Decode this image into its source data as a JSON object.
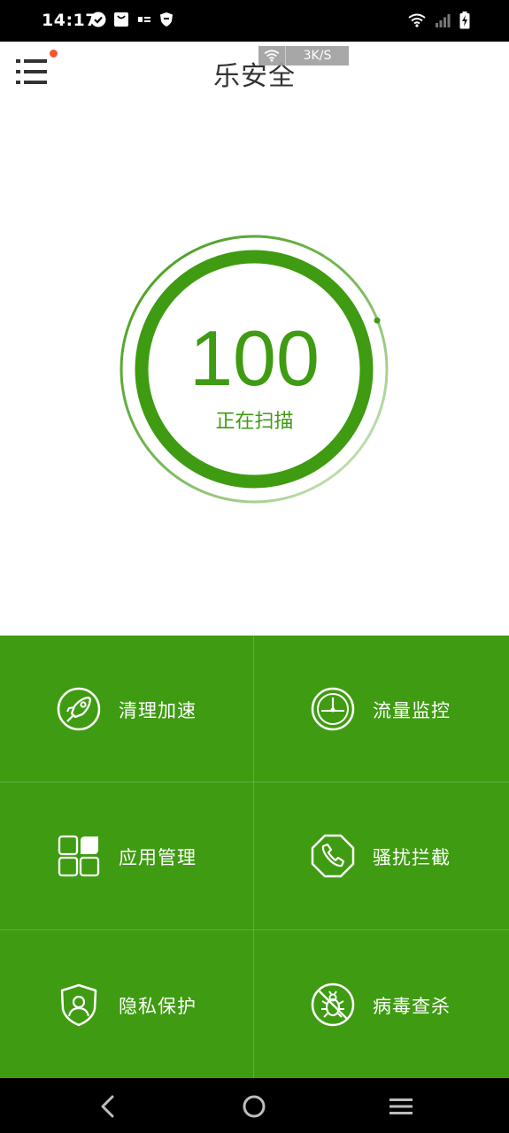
{
  "status_bar": {
    "time": "14:17",
    "notification_icons": [
      "check-circle-icon",
      "shopping-bag-icon",
      "news-app-icon",
      "shield-small-icon"
    ],
    "system_icons": [
      "wifi-icon",
      "signal-icon",
      "battery-charging-icon"
    ]
  },
  "header": {
    "title": "乐安全",
    "menu_icon": "hamburger-menu-icon",
    "has_notification_dot": true,
    "speed_badge": {
      "icon": "wifi-icon",
      "text": "3K/S"
    }
  },
  "score": {
    "value": "100",
    "status": "正在扫描",
    "progress": 1.0
  },
  "features": [
    {
      "label": "清理加速",
      "icon": "rocket-icon"
    },
    {
      "label": "流量监控",
      "icon": "gauge-icon"
    },
    {
      "label": "应用管理",
      "icon": "app-grid-icon"
    },
    {
      "label": "骚扰拦截",
      "icon": "blocked-phone-icon"
    },
    {
      "label": "隐私保护",
      "icon": "privacy-shield-icon"
    },
    {
      "label": "病毒查杀",
      "icon": "virus-kill-icon"
    }
  ],
  "nav_bar": {
    "buttons": [
      "back-icon",
      "home-icon",
      "recents-icon"
    ]
  },
  "colors": {
    "accent": "#3f9b12",
    "notification_dot": "#f2562f",
    "status_bar_bg": "#000000"
  }
}
